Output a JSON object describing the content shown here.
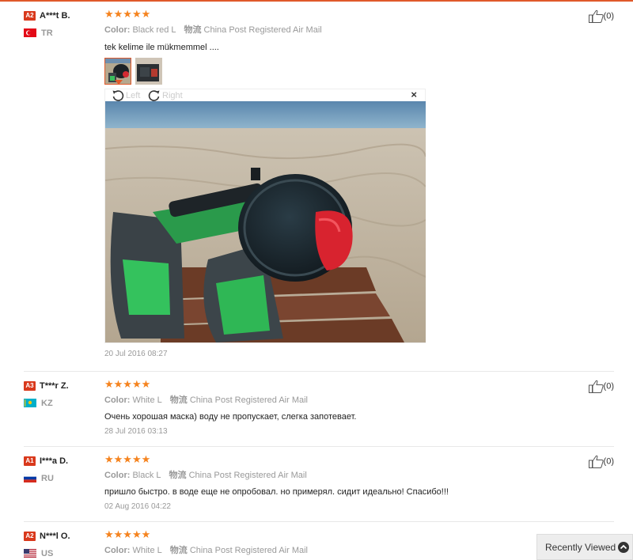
{
  "reviews": [
    {
      "level": "A2",
      "name": "A***t B.",
      "country": "TR",
      "stars": "★★★★★",
      "color_label": "Color:",
      "color_value": "Black red L",
      "ship_label": "物流",
      "ship_value": "China Post Registered Air Mail",
      "text": "tek kelime ile mükmemmel ....",
      "date": "20 Jul 2016 08:27",
      "helpful_count": "(0)"
    },
    {
      "level": "A3",
      "name": "T***r Z.",
      "country": "KZ",
      "stars": "★★★★★",
      "color_label": "Color:",
      "color_value": "White L",
      "ship_label": "物流",
      "ship_value": "China Post Registered Air Mail",
      "text": "Очень хорошая маска) воду не пропускает, слегка запотевает.",
      "date": "28 Jul 2016 03:13",
      "helpful_count": "(0)"
    },
    {
      "level": "A1",
      "name": "I***a D.",
      "country": "RU",
      "stars": "★★★★★",
      "color_label": "Color:",
      "color_value": "Black L",
      "ship_label": "物流",
      "ship_value": "China Post Registered Air Mail",
      "text": "пришло быстро. в воде еще не опробовал. но примерял. сидит идеально! Спасибо!!!",
      "date": "02 Aug 2016 04:22",
      "helpful_count": "(0)"
    },
    {
      "level": "A2",
      "name": "N***l O.",
      "country": "US",
      "stars": "★★★★★",
      "color_label": "Color:",
      "color_value": "White L",
      "ship_label": "物流",
      "ship_value": "China Post Registered Air Mail"
    }
  ],
  "viewer": {
    "rotate_left": "Left",
    "rotate_right": "Right",
    "close": "×"
  },
  "recently_viewed": "Recently Viewed",
  "colors": {
    "accent": "#e0592a",
    "star": "#f5831e",
    "level_badge": "#d9391c"
  }
}
